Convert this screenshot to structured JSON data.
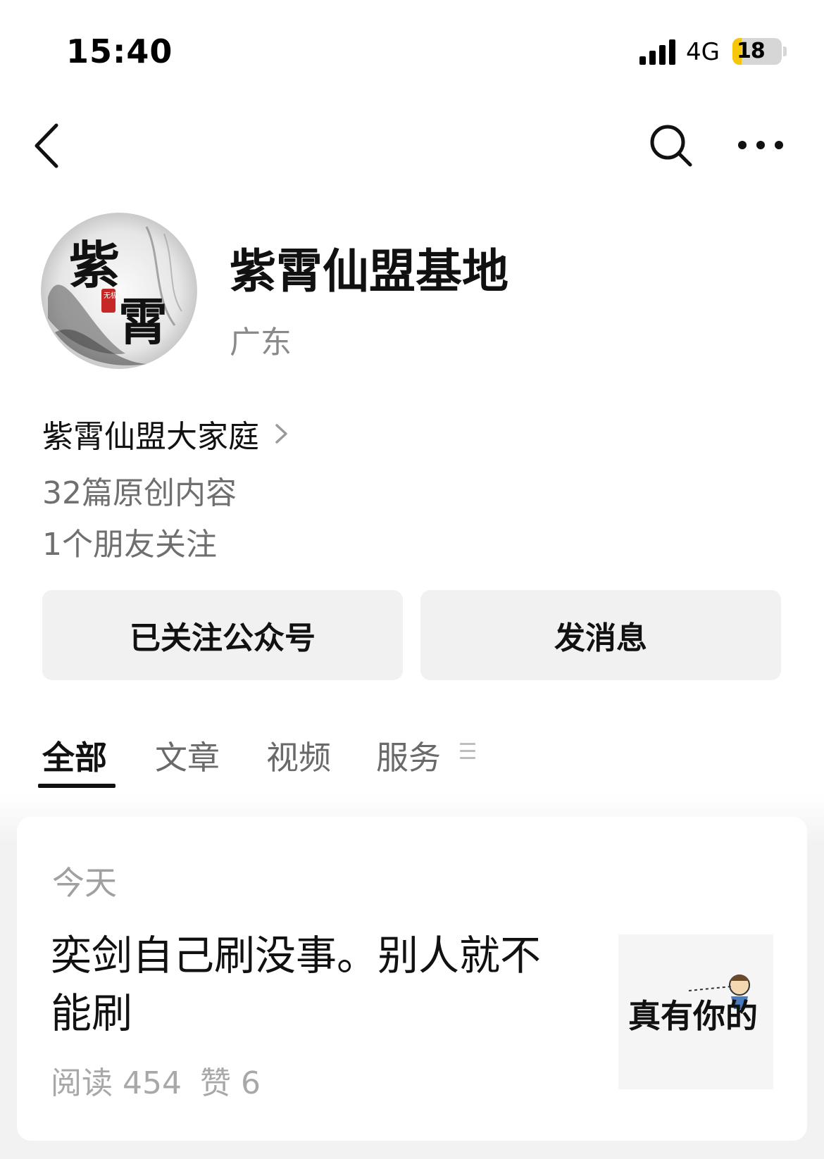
{
  "status_bar": {
    "time": "15:40",
    "network": "4G",
    "battery": "18",
    "battery_level_percent": 18,
    "signal_bars_active": 4
  },
  "nav": {
    "back_icon": "chevron-left-icon",
    "search_icon": "search-icon",
    "more_icon": "more-horizontal-icon"
  },
  "profile": {
    "avatar_text_1": "紫",
    "avatar_text_2": "霄",
    "avatar_seal": "无极",
    "name": "紫霄仙盟基地",
    "region": "广东",
    "entity": "紫霄仙盟大家庭",
    "original_count": "32篇原创内容",
    "friends_follow": "1个朋友关注"
  },
  "actions": {
    "followed_label": "已关注公众号",
    "message_label": "发消息"
  },
  "tabs": [
    {
      "label": "全部",
      "active": true
    },
    {
      "label": "文章",
      "active": false
    },
    {
      "label": "视频",
      "active": false
    },
    {
      "label": "服务",
      "active": false
    }
  ],
  "feed": {
    "date": "今天",
    "article": {
      "title": "奕剑自己刷没事。别人就不能刷",
      "reads": "阅读 454",
      "likes": "赞 6",
      "thumb_text": "真有你的"
    }
  },
  "colors": {
    "accent_text": "#111111",
    "secondary_text": "#8a8a8a",
    "button_bg": "#f1f1f1",
    "battery_fill": "#f6c60b"
  }
}
